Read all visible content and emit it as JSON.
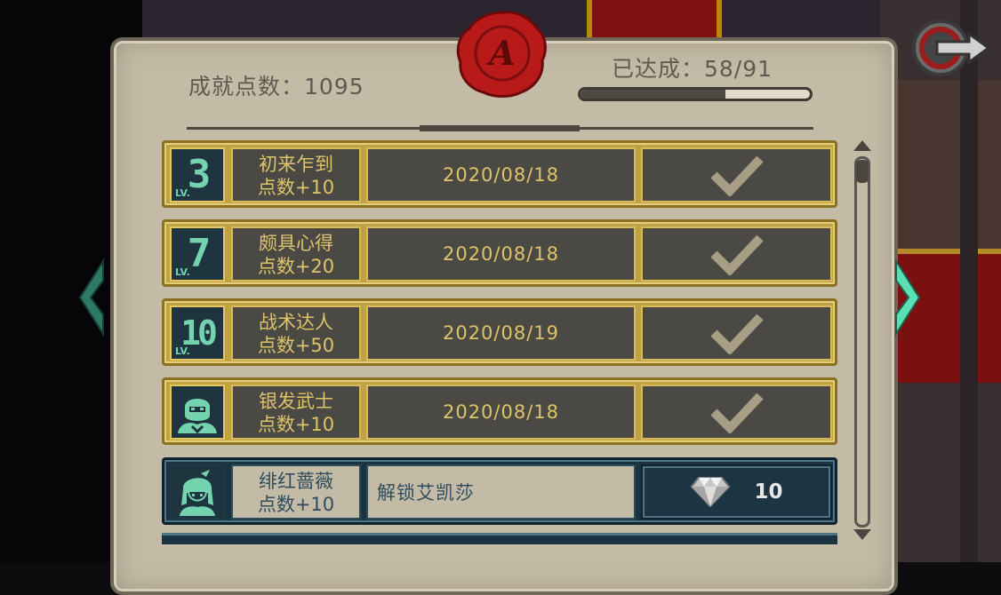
{
  "header": {
    "points_label": "成就点数：1095",
    "progress_label": "已达成：58/91",
    "progress_fraction": 0.63,
    "seal_letter": "A"
  },
  "colors": {
    "gold": "#d8ba58",
    "teal": "#74d2ae",
    "parchment": "#c4bba7",
    "locked_blue": "#1c3442",
    "seal_red": "#b81a1a"
  },
  "achievements": [
    {
      "badge_type": "level",
      "badge_num": "3",
      "badge_lv": "LV.",
      "name": "初来乍到",
      "points": "点数+10",
      "date": "2020/08/18",
      "status_icon": "checkmark-icon",
      "completed": true
    },
    {
      "badge_type": "level",
      "badge_num": "7",
      "badge_lv": "LV.",
      "name": "颇具心得",
      "points": "点数+20",
      "date": "2020/08/18",
      "status_icon": "checkmark-icon",
      "completed": true
    },
    {
      "badge_type": "level",
      "badge_num": "10",
      "badge_lv": "LV.",
      "name": "战术达人",
      "points": "点数+50",
      "date": "2020/08/19",
      "status_icon": "checkmark-icon",
      "completed": true
    },
    {
      "badge_type": "portrait",
      "badge_icon": "silver-hair-warrior-portrait-icon",
      "name": "银发武士",
      "points": "点数+10",
      "date": "2020/08/18",
      "status_icon": "checkmark-icon",
      "completed": true
    },
    {
      "badge_type": "portrait",
      "badge_icon": "crimson-rose-portrait-icon",
      "name": "绯红蔷薇",
      "points": "点数+10",
      "description": "解锁艾凯莎",
      "reward_icon": "diamond-icon",
      "reward_value": "10",
      "completed": false
    }
  ],
  "icons": {
    "back": "back-arrow-icon",
    "prev": "chevron-left-icon",
    "next": "chevron-right-icon",
    "scroll_up": "scroll-up-icon",
    "scroll_down": "scroll-down-icon"
  }
}
